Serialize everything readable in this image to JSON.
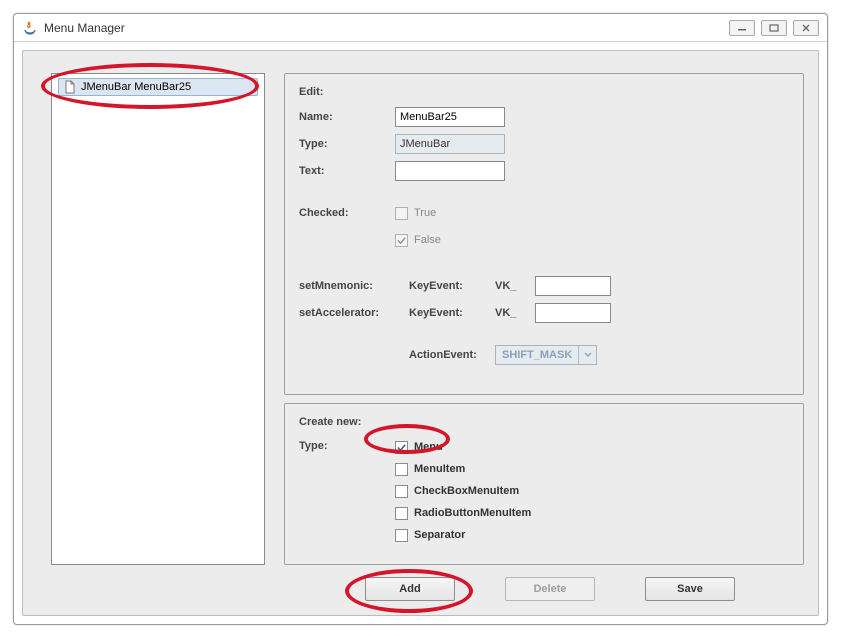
{
  "titlebar": {
    "title": "Menu Manager"
  },
  "tree": {
    "items": [
      {
        "label": "JMenuBar MenuBar25",
        "selected": true
      }
    ]
  },
  "edit": {
    "section_label": "Edit:",
    "name_label": "Name:",
    "name_value": "MenuBar25",
    "type_label": "Type:",
    "type_value": "JMenuBar",
    "text_label": "Text:",
    "text_value": "",
    "checked_label": "Checked:",
    "checked_true_label": "True",
    "checked_false_label": "False",
    "checked_true": false,
    "checked_false": true,
    "mnemonic_label": "setMnemonic:",
    "accelerator_label": "setAccelerator:",
    "keyevent_label": "KeyEvent:",
    "vk_label": "VK_",
    "mnemonic_value": "",
    "accelerator_value": "",
    "actionevent_label": "ActionEvent:",
    "actionevent_value": "SHIFT_MASK"
  },
  "create": {
    "section_label": "Create new:",
    "type_label": "Type:",
    "options": [
      {
        "label": "Menu",
        "checked": true
      },
      {
        "label": "MenuItem",
        "checked": false
      },
      {
        "label": "CheckBoxMenuItem",
        "checked": false
      },
      {
        "label": "RadioButtonMenuItem",
        "checked": false
      },
      {
        "label": "Separator",
        "checked": false
      }
    ]
  },
  "buttons": {
    "add": "Add",
    "delete": "Delete",
    "save": "Save"
  }
}
